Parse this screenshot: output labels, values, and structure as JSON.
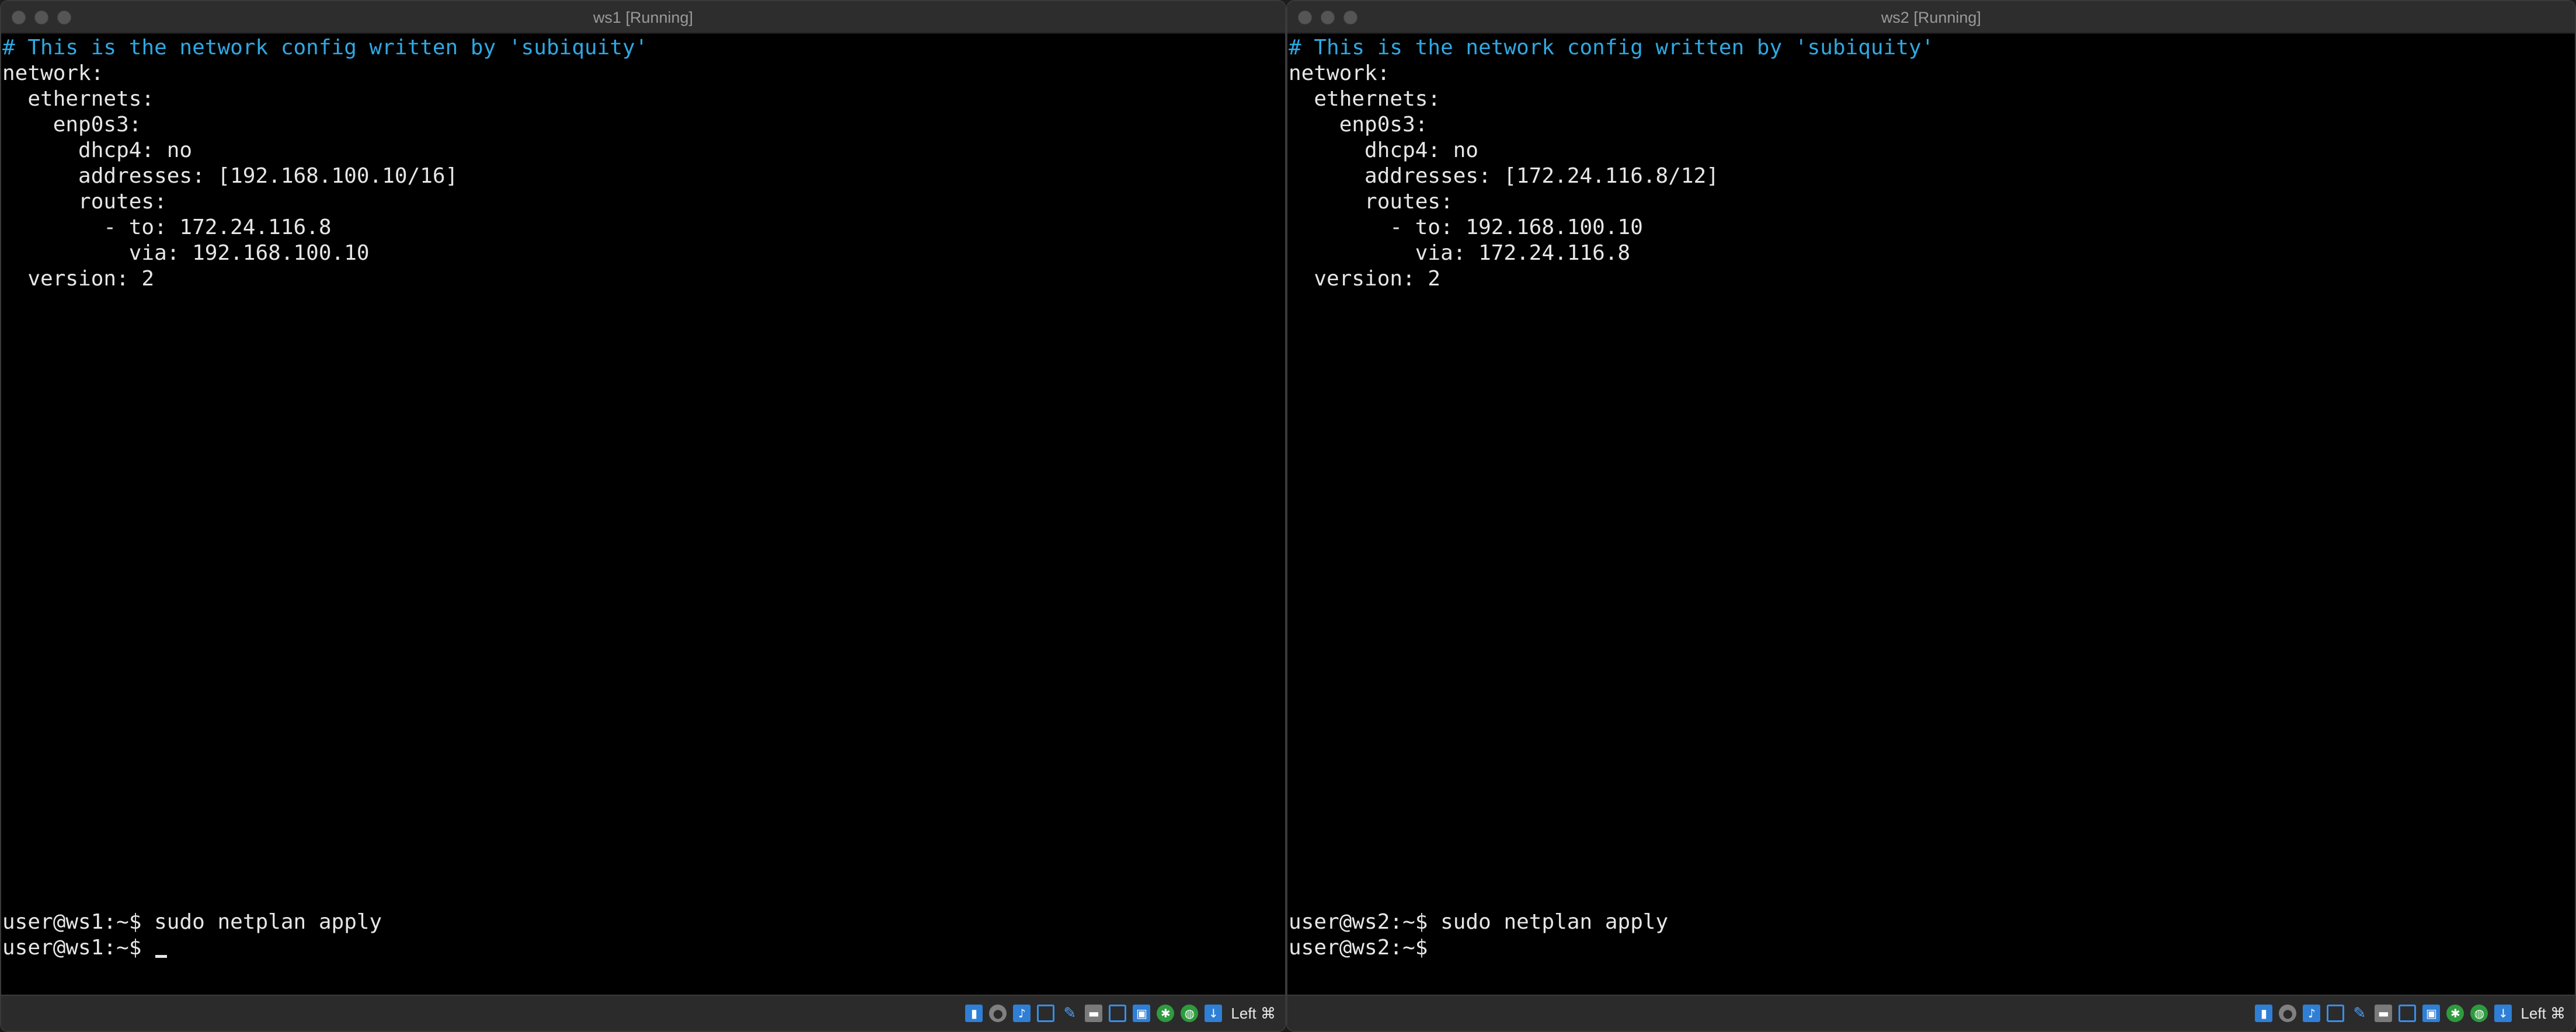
{
  "windows": [
    {
      "title": "ws1 [Running]",
      "lines": [
        "# This is the network config written by 'subiquity'",
        "network:",
        "  ethernets:",
        "    enp0s3:",
        "      dhcp4: no",
        "      addresses: [192.168.100.10/16]",
        "      routes:",
        "        - to: 172.24.116.8",
        "          via: 192.168.100.10",
        "  version: 2"
      ],
      "prompt_history": "user@ws1:~$ sudo netplan apply",
      "prompt_current": "user@ws1:~$ ",
      "host_key": "Left ⌘"
    },
    {
      "title": "ws2 [Running]",
      "lines": [
        "# This is the network config written by 'subiquity'",
        "network:",
        "  ethernets:",
        "    enp0s3:",
        "      dhcp4: no",
        "      addresses: [172.24.116.8/12]",
        "      routes:",
        "        - to: 192.168.100.10",
        "          via: 172.24.116.8",
        "  version: 2"
      ],
      "prompt_history": "user@ws2:~$ sudo netplan apply",
      "prompt_current": "user@ws2:~$ ",
      "host_key": "Left ⌘"
    }
  ],
  "status_icons": [
    "hard-disk-icon",
    "optical-drive-icon",
    "audio-icon",
    "network-icon",
    "usb-icon",
    "shared-folders-icon",
    "display-icon",
    "video-capture-icon",
    "recording-icon",
    "cpu-activity-icon",
    "guest-additions-icon",
    "mouse-integration-icon"
  ],
  "colors": {
    "terminal_bg": "#000000",
    "terminal_fg": "#e6e6e6",
    "comment": "#2fa8e2",
    "titlebar_bg": "#2d2d2d",
    "statusbar_bg": "#2b2b2b"
  }
}
